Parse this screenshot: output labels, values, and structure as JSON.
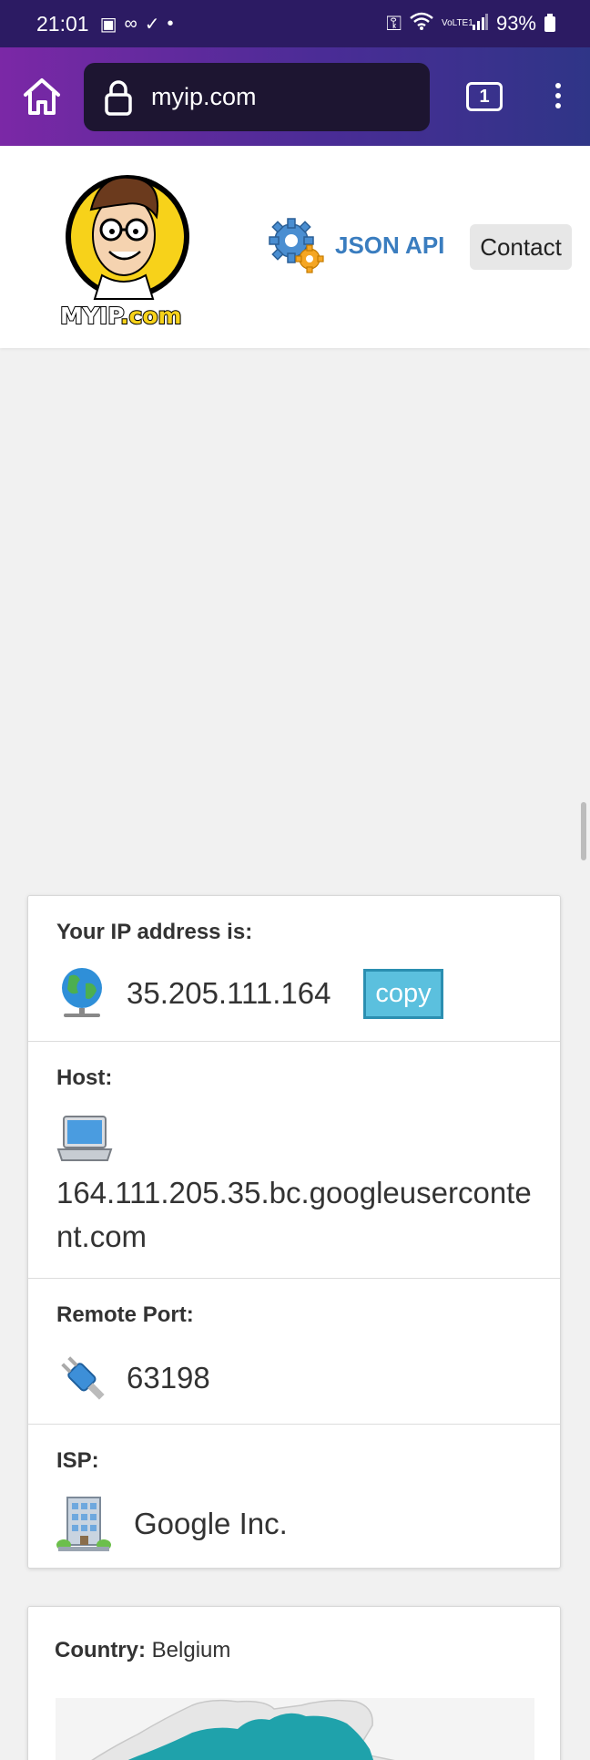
{
  "status_bar": {
    "time": "21:01",
    "battery": "93%",
    "network": "VoLTE1",
    "icons": [
      "image-icon",
      "voicemail-icon",
      "check-circle-icon",
      "dot-icon",
      "key-icon",
      "wifi-icon",
      "signal-icon",
      "battery-icon"
    ]
  },
  "browser": {
    "url": "myip.com",
    "tab_count": "1",
    "icons": [
      "home-icon",
      "lock-icon",
      "tabs-icon",
      "more-vert-icon"
    ]
  },
  "site": {
    "logo_text_main": "MYIP",
    "logo_text_suffix": ".com",
    "json_api_label": "JSON API",
    "contact_label": "Contact"
  },
  "ip_info": {
    "ip_label": "Your IP address is:",
    "ip_value": "35.205.111.164",
    "copy_label": "copy",
    "host_label": "Host:",
    "host_value": "164.111.205.35.bc.googleusercontent.com",
    "port_label": "Remote Port:",
    "port_value": "63198",
    "isp_label": "ISP:",
    "isp_value": "Google Inc."
  },
  "country": {
    "label": "Country:",
    "value": "Belgium"
  },
  "colors": {
    "status_bar": "#2c1b63",
    "toolbar_gradient_start": "#7b28a6",
    "toolbar_gradient_end": "#2f3587",
    "link_blue": "#3a7dbf",
    "copy_button": "#5bc0de",
    "map_teal": "#1fa2ab"
  }
}
